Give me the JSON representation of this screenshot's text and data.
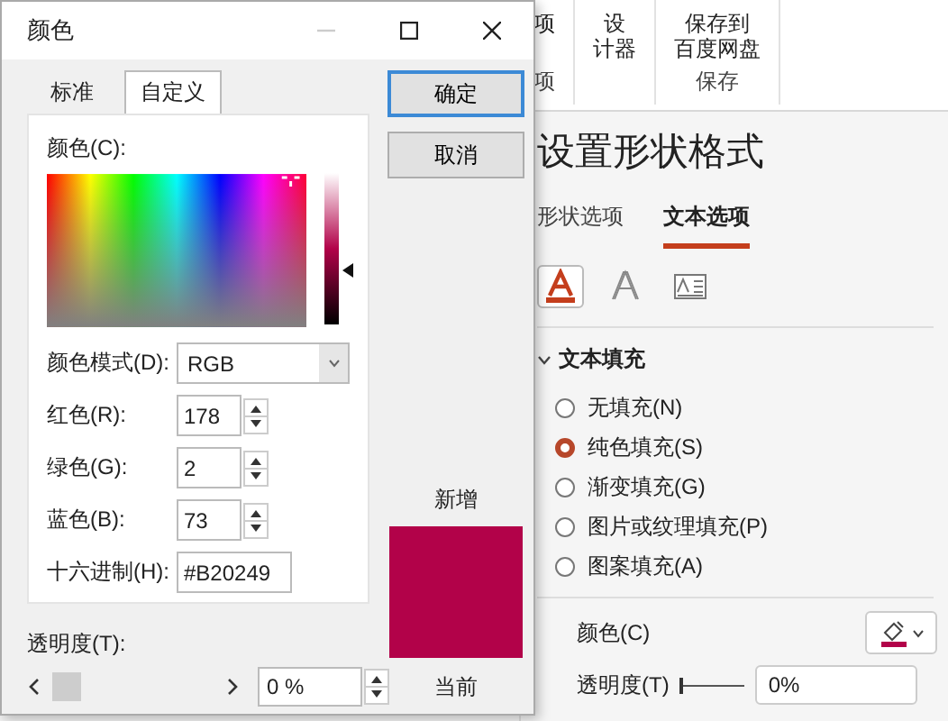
{
  "ribbon": {
    "groups": [
      {
        "buttons": [
          {
            "lines": [
              "项"
            ]
          }
        ],
        "label": "项"
      },
      {
        "buttons": [
          {
            "lines": [
              "设",
              "计器"
            ]
          }
        ]
      },
      {
        "buttons": [
          {
            "lines": [
              "保存到",
              "百度网盘"
            ]
          }
        ],
        "label": "保存"
      }
    ]
  },
  "format_pane": {
    "title": "设置形状格式",
    "tabs": [
      {
        "label": "形状选项",
        "selected": false
      },
      {
        "label": "文本选项",
        "selected": true
      }
    ],
    "icon_tabs": [
      {
        "kind": "fill",
        "selected": true
      },
      {
        "kind": "outline",
        "selected": false
      },
      {
        "kind": "textbox",
        "selected": false
      }
    ],
    "section": {
      "title": "文本填充",
      "expanded": true,
      "options": [
        {
          "label": "无填充(N)",
          "selected": false
        },
        {
          "label": "纯色填充(S)",
          "selected": true
        },
        {
          "label": "渐变填充(G)",
          "selected": false
        },
        {
          "label": "图片或纹理填充(P)",
          "selected": false
        },
        {
          "label": "图案填充(A)",
          "selected": false
        }
      ],
      "color_label": "颜色(C)",
      "transparency_label": "透明度(T)",
      "transparency": {
        "level": 0
      },
      "transparency_value": "0%"
    }
  },
  "dialog": {
    "title": "颜色",
    "tabs": [
      {
        "label": "标准",
        "selected": false
      },
      {
        "label": "自定义",
        "selected": true
      }
    ],
    "spectrum_label": "颜色(C):",
    "luminance": {
      "level": 0.36
    },
    "mode_label": "颜色模式(D):",
    "mode": "RGB",
    "channels": [
      {
        "label": "红色(R):",
        "value": "178"
      },
      {
        "label": "绿色(G):",
        "value": "2"
      },
      {
        "label": "蓝色(B):",
        "value": "73"
      }
    ],
    "hex_label": "十六进制(H):",
    "hex": "#B20249",
    "buttons": [
      "确定",
      "取消"
    ],
    "new_label": "新增",
    "current_label": "当前",
    "transparency": {
      "label": "透明度(T):",
      "level": 0,
      "value": "0 %"
    }
  }
}
